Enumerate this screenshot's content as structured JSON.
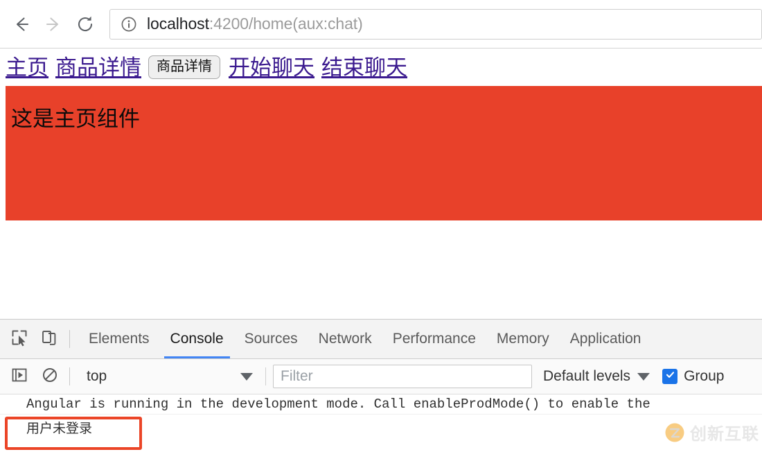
{
  "browser": {
    "back_icon": "arrow-left-icon",
    "forward_icon": "arrow-right-icon",
    "reload_icon": "reload-icon",
    "omnibox": {
      "info_icon": "info-circle-icon",
      "url_host": "localhost",
      "url_rest": ":4200/home(aux:chat)",
      "url_full": "localhost:4200/home(aux:chat)"
    }
  },
  "page": {
    "nav": [
      {
        "label": "主页",
        "type": "link"
      },
      {
        "label": "商品详情",
        "type": "link"
      },
      {
        "label": "商品详情",
        "type": "button"
      },
      {
        "label": "开始聊天",
        "type": "link"
      },
      {
        "label": "结束聊天",
        "type": "link"
      }
    ],
    "banner": {
      "text": "这是主页组件",
      "background_color": "#e8412a"
    }
  },
  "devtools": {
    "inspect_icon": "cursor-select-icon",
    "device_toolbar_icon": "device-toggle-icon",
    "tabs": [
      {
        "label": "Elements",
        "active": false
      },
      {
        "label": "Console",
        "active": true
      },
      {
        "label": "Sources",
        "active": false
      },
      {
        "label": "Network",
        "active": false
      },
      {
        "label": "Performance",
        "active": false
      },
      {
        "label": "Memory",
        "active": false
      },
      {
        "label": "Application",
        "active": false
      }
    ],
    "active_tab": "Console",
    "active_tab_color": "#4285f4",
    "toolbar": {
      "execute_icon": "execute-sidebar-icon",
      "clear_icon": "clear-console-icon",
      "context_value": "top",
      "context_caret_icon": "chevron-down-icon",
      "filter_placeholder": "Filter",
      "filter_value": "",
      "levels_value": "Default levels",
      "levels_caret_icon": "chevron-down-icon",
      "group_checkbox_checked": true,
      "group_check_icon": "checkmark-icon",
      "group_label": "Group",
      "checkbox_color": "#1a73e8"
    },
    "messages": [
      {
        "text": "Angular is running in the development mode. Call enableProdMode() to enable the"
      },
      {
        "text": "用户未登录",
        "highlighted": true
      }
    ]
  },
  "annotation": {
    "box_color": "#eb4527"
  },
  "watermark": {
    "logo_icon": "cx-logo-icon",
    "text": "创新互联"
  }
}
